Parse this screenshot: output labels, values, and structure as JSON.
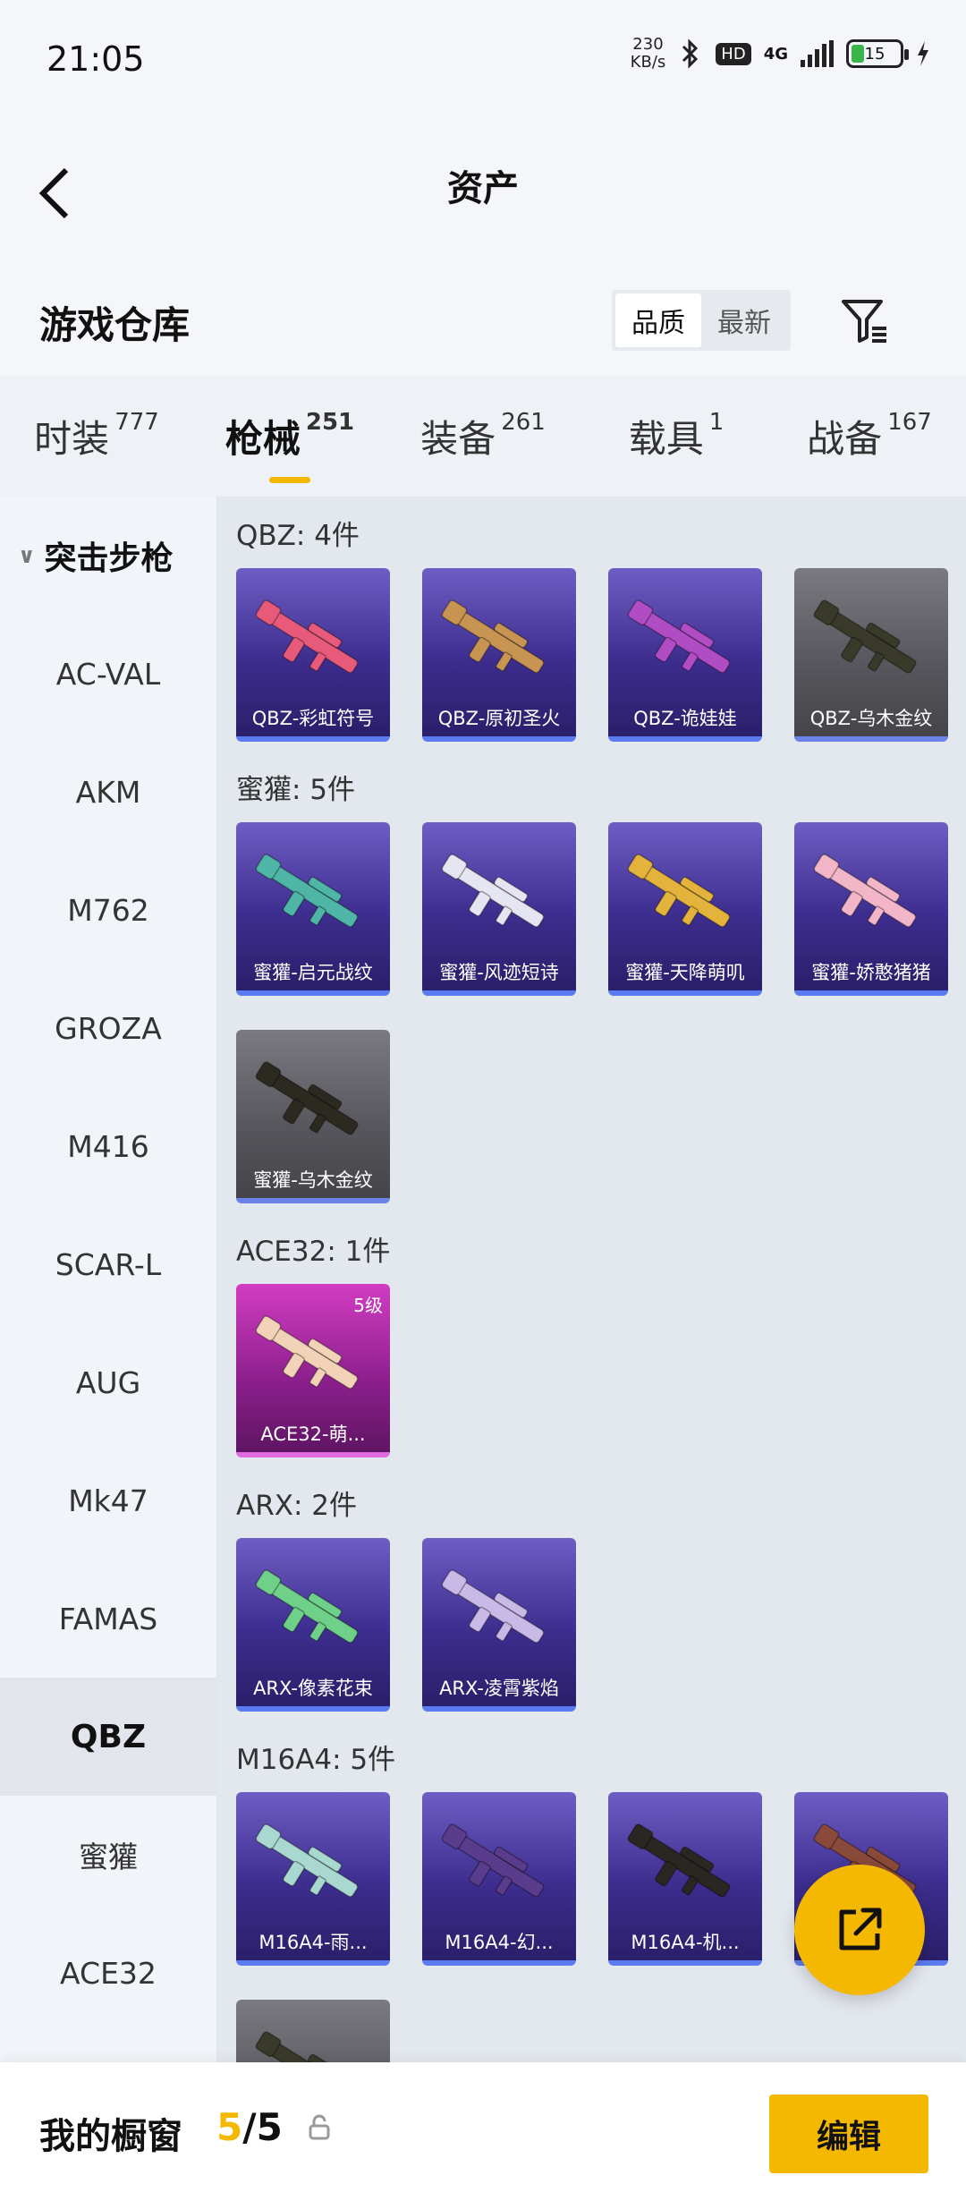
{
  "status_bar": {
    "time": "21:05",
    "net_speed_value": "230",
    "net_speed_unit": "KB/s",
    "network": "4G",
    "battery": "15",
    "hd": "HD"
  },
  "header": {
    "title": "资产"
  },
  "warehouse": {
    "title": "游戏仓库",
    "sort_options": [
      "品质",
      "最新"
    ],
    "active_sort": "品质"
  },
  "tabs": [
    {
      "label": "时装",
      "count": "777"
    },
    {
      "label": "枪械",
      "count": "251"
    },
    {
      "label": "装备",
      "count": "261"
    },
    {
      "label": "载具",
      "count": "1"
    },
    {
      "label": "战备",
      "count": "167"
    }
  ],
  "active_tab": "枪械",
  "sidebar": {
    "category": "突击步枪",
    "items": [
      "AC-VAL",
      "AKM",
      "M762",
      "GROZA",
      "M416",
      "SCAR-L",
      "AUG",
      "Mk47",
      "FAMAS",
      "QBZ",
      "蜜獾",
      "ACE32"
    ],
    "active_item": "QBZ"
  },
  "groups": [
    {
      "title": "QBZ: 4件",
      "items": [
        {
          "label": "QBZ-彩虹符号",
          "color": "#e85a7a",
          "rarity": "purple"
        },
        {
          "label": "QBZ-原初圣火",
          "color": "#c79452",
          "rarity": "purple"
        },
        {
          "label": "QBZ-诡娃娃",
          "color": "#b04cc4",
          "rarity": "purple"
        },
        {
          "label": "QBZ-乌木金纹",
          "color": "#3a3a2a",
          "rarity": "gray"
        }
      ]
    },
    {
      "title": "蜜獾: 5件",
      "items": [
        {
          "label": "蜜獾-启元战纹",
          "color": "#4fb5a6",
          "rarity": "purple"
        },
        {
          "label": "蜜獾-风迹短诗",
          "color": "#e6e6f2",
          "rarity": "purple"
        },
        {
          "label": "蜜獾-天降萌叽",
          "color": "#e3b33c",
          "rarity": "purple"
        },
        {
          "label": "蜜獾-娇憨猪猪",
          "color": "#f2b6c8",
          "rarity": "purple"
        },
        {
          "label": "蜜獾-乌木金纹",
          "color": "#2c2a20",
          "rarity": "gray"
        }
      ]
    },
    {
      "title": "ACE32: 1件",
      "items": [
        {
          "label": "ACE32-萌...",
          "color": "#f3d3b8",
          "rarity": "pink",
          "level": "5级"
        }
      ]
    },
    {
      "title": "ARX: 2件",
      "items": [
        {
          "label": "ARX-像素花束",
          "color": "#6fd08a",
          "rarity": "purple"
        },
        {
          "label": "ARX-凌霄紫焰",
          "color": "#c9b9e6",
          "rarity": "purple"
        }
      ]
    },
    {
      "title": "M16A4: 5件",
      "items": [
        {
          "label": "M16A4-雨...",
          "color": "#a8d8d0",
          "rarity": "purple"
        },
        {
          "label": "M16A4-幻...",
          "color": "#5a3c8c",
          "rarity": "purple"
        },
        {
          "label": "M16A4-机...",
          "color": "#2a2622",
          "rarity": "purple"
        },
        {
          "label": "",
          "color": "#8a4a3a",
          "rarity": "purple"
        },
        {
          "label": "",
          "color": "#3a3a2a",
          "rarity": "gray"
        }
      ]
    }
  ],
  "bottom": {
    "showcase_label": "我的橱窗",
    "showcase_current": "5",
    "showcase_total": "/5",
    "edit_label": "编辑"
  },
  "colors": {
    "accent": "#f5b800"
  }
}
